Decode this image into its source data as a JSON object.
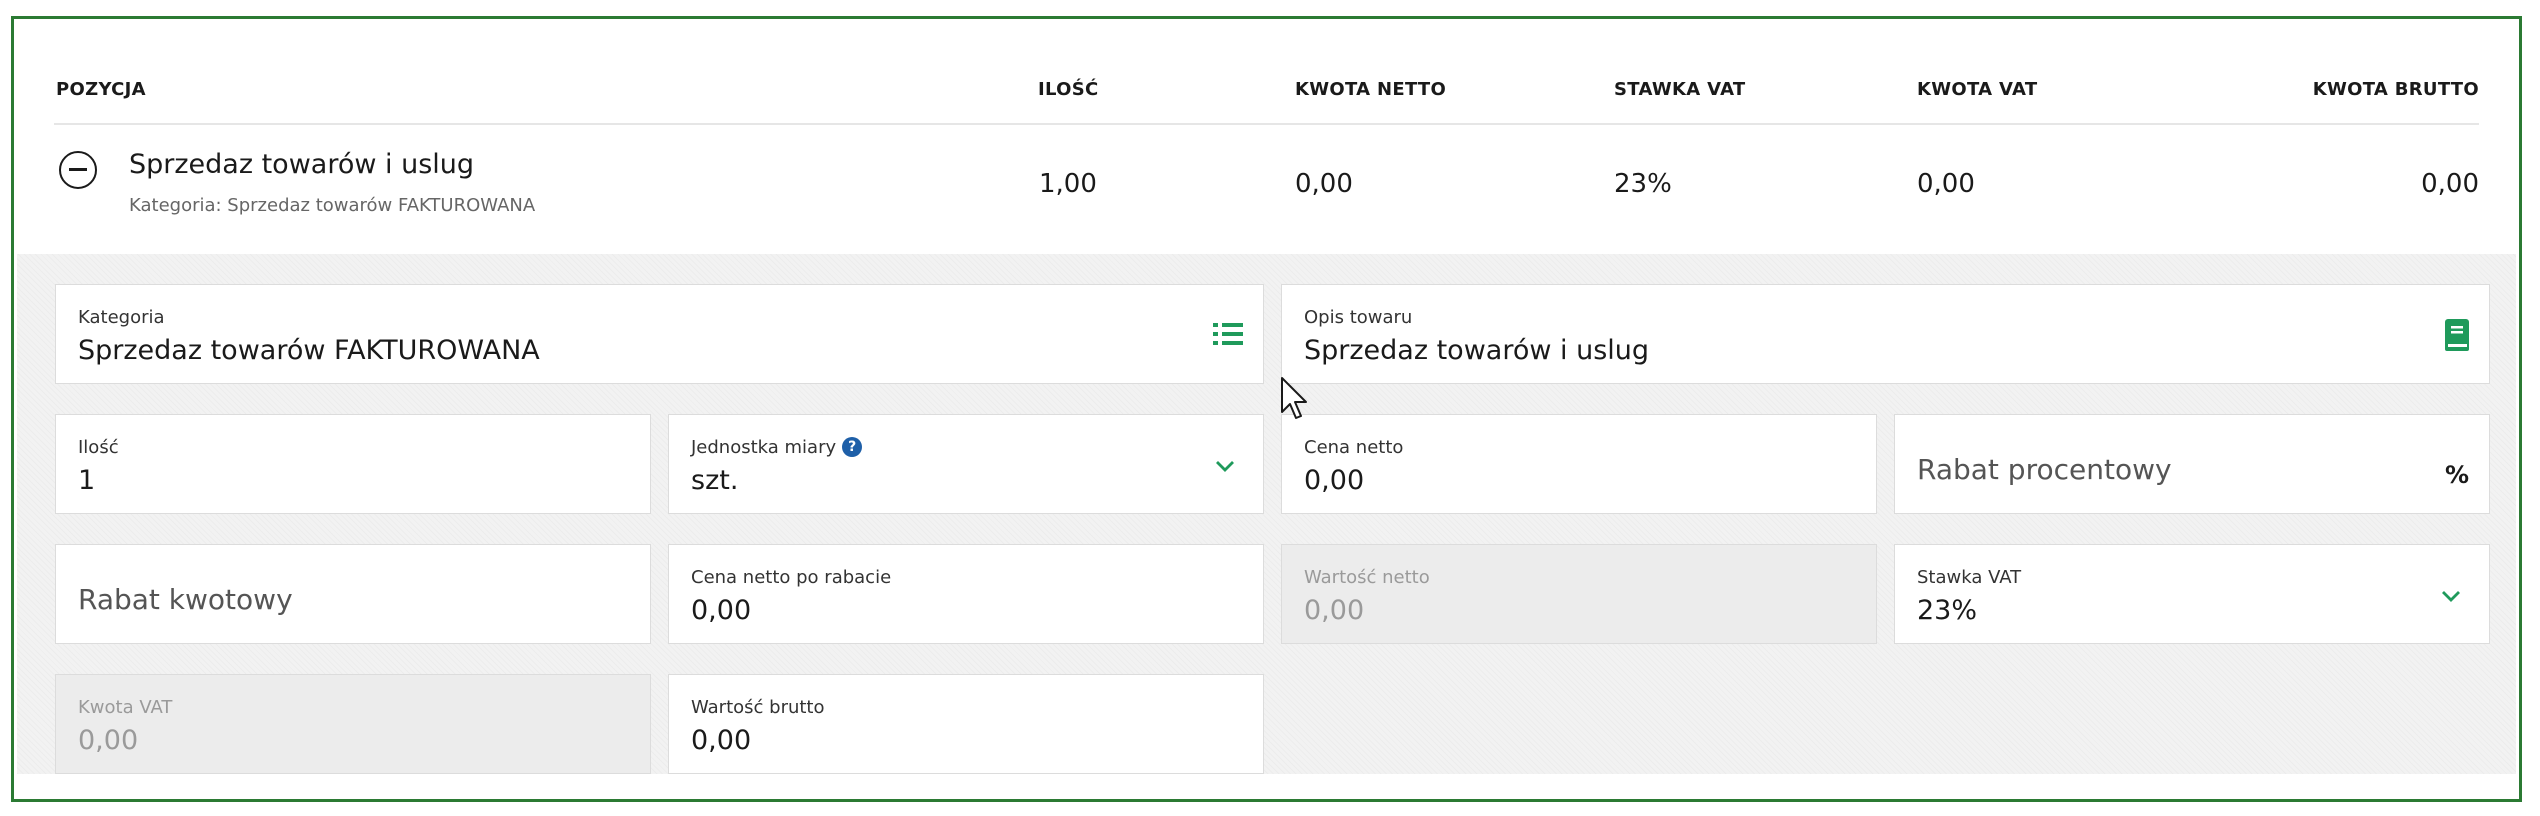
{
  "table": {
    "headers": {
      "pozycja": "POZYCJA",
      "ilosc": "ILOŚĆ",
      "kwota_netto": "KWOTA NETTO",
      "stawka_vat": "STAWKA VAT",
      "kwota_vat": "KWOTA VAT",
      "kwota_brutto": "KWOTA BRUTTO"
    },
    "item": {
      "title": "Sprzedaz towarów i uslug",
      "category": "Kategoria: Sprzedaz towarów FAKTUROWANA",
      "ilosc": "1,00",
      "kwota_netto": "0,00",
      "stawka_vat": "23%",
      "kwota_vat": "0,00",
      "kwota_brutto": "0,00"
    }
  },
  "form": {
    "kategoria": {
      "label": "Kategoria",
      "value": "Sprzedaz towarów FAKTUROWANA",
      "icon": "list-icon"
    },
    "opis_towaru": {
      "label": "Opis towaru",
      "value": "Sprzedaz towarów i uslug",
      "icon": "book-icon"
    },
    "ilosc": {
      "label": "Ilość",
      "value": "1"
    },
    "jednostka_miary": {
      "label": "Jednostka miary",
      "value": "szt.",
      "help": "?"
    },
    "cena_netto": {
      "label": "Cena netto",
      "value": "0,00"
    },
    "rabat_procentowy": {
      "placeholder": "Rabat procentowy",
      "unit": "%"
    },
    "rabat_kwotowy": {
      "placeholder": "Rabat kwotowy"
    },
    "cena_netto_po_rabacie": {
      "label": "Cena netto po rabacie",
      "value": "0,00"
    },
    "wartosc_netto": {
      "label": "Wartość netto",
      "value": "0,00",
      "disabled": true
    },
    "stawka_vat": {
      "label": "Stawka VAT",
      "value": "23%"
    },
    "kwota_vat": {
      "label": "Kwota VAT",
      "value": "0,00",
      "disabled": true
    },
    "wartosc_brutto": {
      "label": "Wartość brutto",
      "value": "0,00"
    }
  },
  "colors": {
    "accent": "#1f9a5b",
    "frame_border": "#2b7a33",
    "help_icon": "#1e5fa8"
  }
}
